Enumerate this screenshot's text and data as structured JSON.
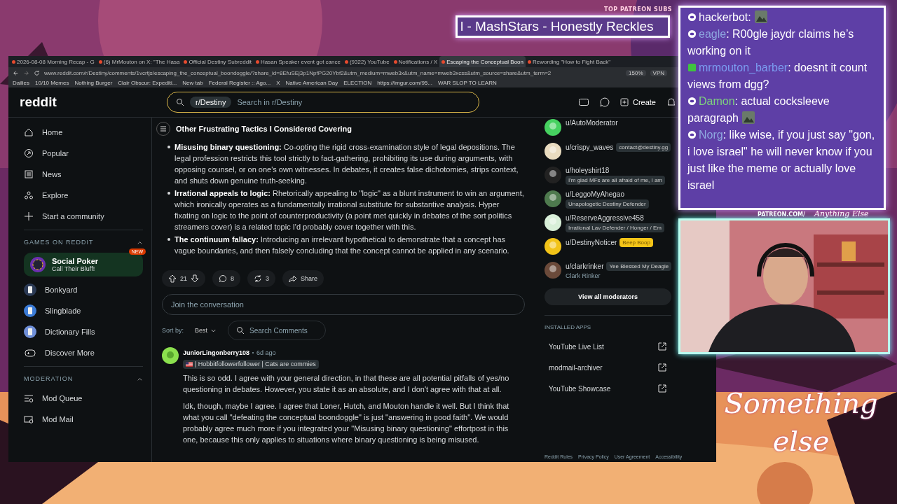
{
  "overlay": {
    "patreon_header": "TOP PATREON SUBS",
    "patreon_ticker": "l - MashStars - Honestly Reckles",
    "patreon_url": "PATREON.COM/",
    "script_tag": "Anything Else",
    "logo": "Something else"
  },
  "chat": [
    {
      "user": "hackerbot",
      "kind": "dgg",
      "color": "#ffffff",
      "text": ":",
      "emote": true
    },
    {
      "user": "eagle",
      "kind": "dgg",
      "color": "#8fa8e0",
      "text": ": R00gle jaydr claims he’s working on it",
      "emote": false
    },
    {
      "user": "mrmouton_barber",
      "kind": "sub",
      "color": "#7b9cf0",
      "text": ": doesnt it count views from dgg?",
      "emote": false
    },
    {
      "user": "Damon",
      "kind": "dgg",
      "color": "#7fd17f",
      "text": ": actual cocksleeve paragraph",
      "emote": true
    },
    {
      "user": "Norg",
      "kind": "dgg",
      "color": "#8fa8e0",
      "text": ": like wise, if you just say \"gon, i love israel\" he will never know if you just like the meme or actually love israel",
      "emote": false
    }
  ],
  "browser": {
    "tabs": [
      {
        "label": "2026-08-08 Morning Recap - G",
        "selected": false
      },
      {
        "label": "(6) MrMouton on X: \"The Hasa",
        "selected": false
      },
      {
        "label": "Official Destiny Subreddit",
        "selected": false
      },
      {
        "label": "Hasan Speaker event got cance",
        "selected": false
      },
      {
        "label": "(9322) YouTube",
        "selected": false
      },
      {
        "label": "Notifications / X",
        "selected": false
      },
      {
        "label": "Escaping the Conceptual Boon",
        "selected": true
      },
      {
        "label": "Rewording \"How to Fight Back\"",
        "selected": false
      }
    ],
    "url": "www.reddit.com/r/Destiny/comments/1vcrtjs/escaping_the_conceptual_boondoggle/?share_id=8EfuSEj3p1NpfPG20Ybf2&utm_medium=mweb3x&utm_name=mweb3xcss&utm_source=share&utm_term=2",
    "zoom": "150%",
    "vpn": "VPN",
    "bookmarks": [
      "Dailies",
      "10/10 Memes",
      "Nothing Burger",
      "Clair Obscur: Expediti...",
      "New tab",
      "Federal Register :: Ago...",
      "X",
      "Native American Day",
      "ELECTION",
      "https://imgur.com/95...",
      "WAR SLOP TO LEARN"
    ]
  },
  "header": {
    "logo": "reddit",
    "community_chip": "r/Destiny",
    "search_placeholder": "Search in r/Destiny",
    "create": "Create"
  },
  "sidebar": {
    "items": [
      "Home",
      "Popular",
      "News",
      "Explore",
      "Start a community"
    ],
    "games": {
      "title": "GAMES ON REDDIT",
      "expanded": true,
      "featured": {
        "title": "Social Poker",
        "subtitle": "Call Their Bluff!",
        "badge": "NEW"
      },
      "items": [
        "Bonkyard",
        "Slingblade",
        "Dictionary Fills",
        "Discover More"
      ]
    },
    "moderation": {
      "title": "MODERATION",
      "expanded": true,
      "items": [
        "Mod Queue",
        "Mod Mail"
      ]
    }
  },
  "post": {
    "heading": "Other Frustrating Tactics I Considered Covering",
    "bullets": [
      "**Misusing binary questioning:** Co-opting the rigid cross-examination style of legal depositions. The legal profession restricts this tool strictly to fact-gathering, prohibiting its use during arguments, with opposing counsel, or on one's own witnesses. In debates, it creates false dichotomies, strips context, and shuts down genuine truth-seeking.",
      "**Irrational appeals to logic:** Rhetorically appealing to \"logic\" as a blunt instrument to win an argument, which ironically operates as a fundamentally irrational substitute for substantive analysis. Hyper fixating on logic to the point of counterproductivity (a point met quickly in debates of the sort politics streamers cover) is a related topic I'd probably cover together with this.",
      "**The continuum fallacy:** Introducing an irrelevant hypothetical to demonstrate that a concept has vague boundaries, and then falsely concluding that the concept cannot be applied in any scenario."
    ],
    "votes": "21",
    "comments": "8",
    "crossposts": "3",
    "share": "Share",
    "reply_placeholder": "Join the conversation",
    "sort_label": "Sort by:",
    "sort_value": "Best",
    "comment_search_placeholder": "Search Comments"
  },
  "comment": {
    "author": "JuniorLingonberry108",
    "age": "6d ago",
    "flair": "| Hobbitfollowerfollower | Cats are commies",
    "paragraphs": [
      "This is so odd. I agree with your general direction, in that these are all potential pitfalls of yes/no questioning in debates. However, you state it as an absolute, and I don't agree with that at all.",
      "Idk, though, maybe I agree. I agree that Loner, Hutch, and Mouton handle it well. But I think that what you call \"defeating the conceptual boondoggle\" is just \"answering in good faith\". We would probably agree much more if you integrated your \"Misusing binary questioning\" effortpost in this one, because this only applies to situations where binary questioning is being misused."
    ]
  },
  "moderators": {
    "list": [
      {
        "name": "u/AutoModerator"
      },
      {
        "name": "u/crispy_waves",
        "flair": {
          "text": "contact@destiny.gg",
          "color": "#2a3236"
        }
      },
      {
        "name": "u/holeyshirt18",
        "flair": {
          "text": "I'm glad MFs are all afraid of me, I am",
          "color": "#2a3236"
        }
      },
      {
        "name": "u/LeggoMyAhegao",
        "flair": {
          "text": "Unapologetic Destiny Defender",
          "color": "#2a3236"
        }
      },
      {
        "name": "u/ReserveAggressive458",
        "flair": {
          "text": "Irrational Lav Defender / Honger / Em",
          "color": "#2a3236"
        }
      },
      {
        "name": "u/DestinyNoticer",
        "flair": {
          "text": "Beep Boop",
          "color": "#f5c518"
        }
      },
      {
        "name": "u/clarkrinker",
        "flair": {
          "text": "Yee Blessed My Deagle",
          "color": "#2a3236"
        },
        "display_name": "Clark Rinker"
      }
    ],
    "view_all": "View all moderators",
    "apps_title": "INSTALLED APPS",
    "apps": [
      "YouTube Live List",
      "modmail-archiver",
      "YouTube Showcase"
    ]
  },
  "footer": [
    "Reddit Rules",
    "Privacy Policy",
    "User Agreement",
    "Accessibility"
  ]
}
